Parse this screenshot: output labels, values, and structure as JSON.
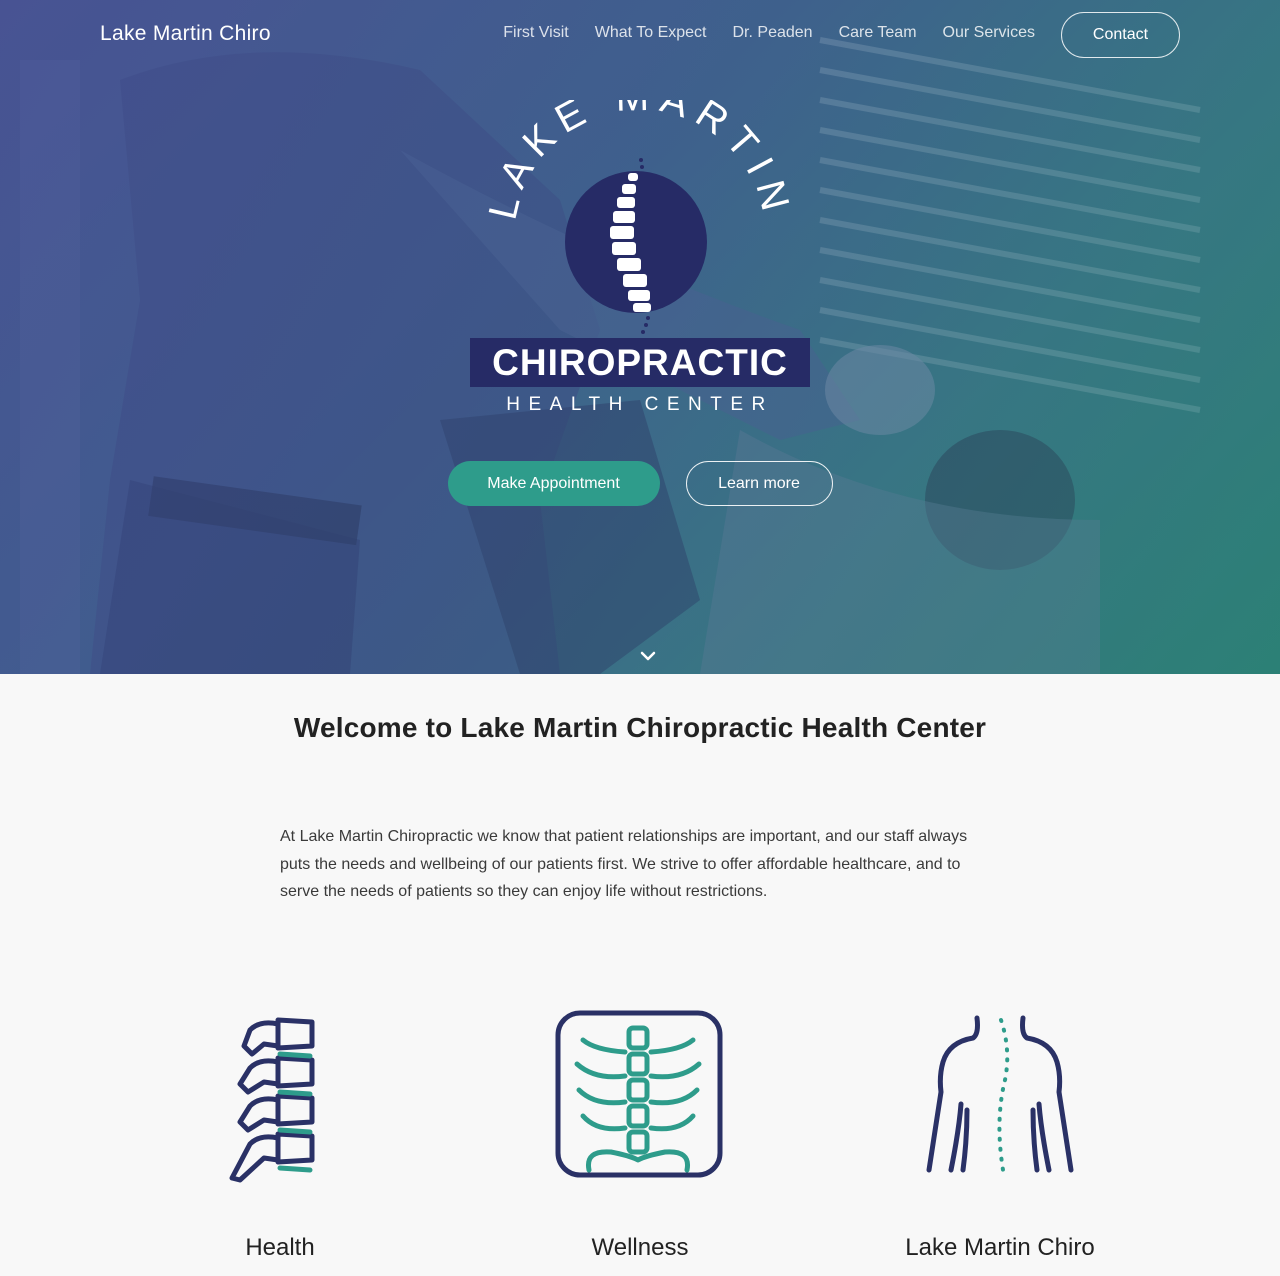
{
  "nav": {
    "brand": "Lake Martin Chiro",
    "links": [
      "First Visit",
      "What To Expect",
      "Dr. Peaden",
      "Care Team",
      "Our Services"
    ],
    "contact_label": "Contact"
  },
  "hero": {
    "logo": {
      "arc_text": "LAKE MARTIN",
      "main_text": "CHIROPRACTIC",
      "sub_text": "HEALTH CENTER"
    },
    "primary_button": "Make Appointment",
    "secondary_button": "Learn more",
    "scroll_icon": "chevron-down-icon"
  },
  "welcome": {
    "title": "Welcome to Lake Martin Chiropractic Health Center",
    "body": "At Lake Martin Chiropractic we know that patient relationships are important, and our staff always puts the needs and wellbeing of our patients first. We strive to offer affordable healthcare, and to serve the needs of patients so they can enjoy life without restrictions."
  },
  "features": [
    {
      "title": "Health",
      "icon": "vertebrae-icon"
    },
    {
      "title": "Wellness",
      "icon": "xray-spine-icon"
    },
    {
      "title": "Lake Martin Chiro",
      "icon": "back-spine-icon"
    }
  ],
  "colors": {
    "navy": "#262b66",
    "teal": "#2e9c8b",
    "icon_navy": "#2a3166"
  }
}
